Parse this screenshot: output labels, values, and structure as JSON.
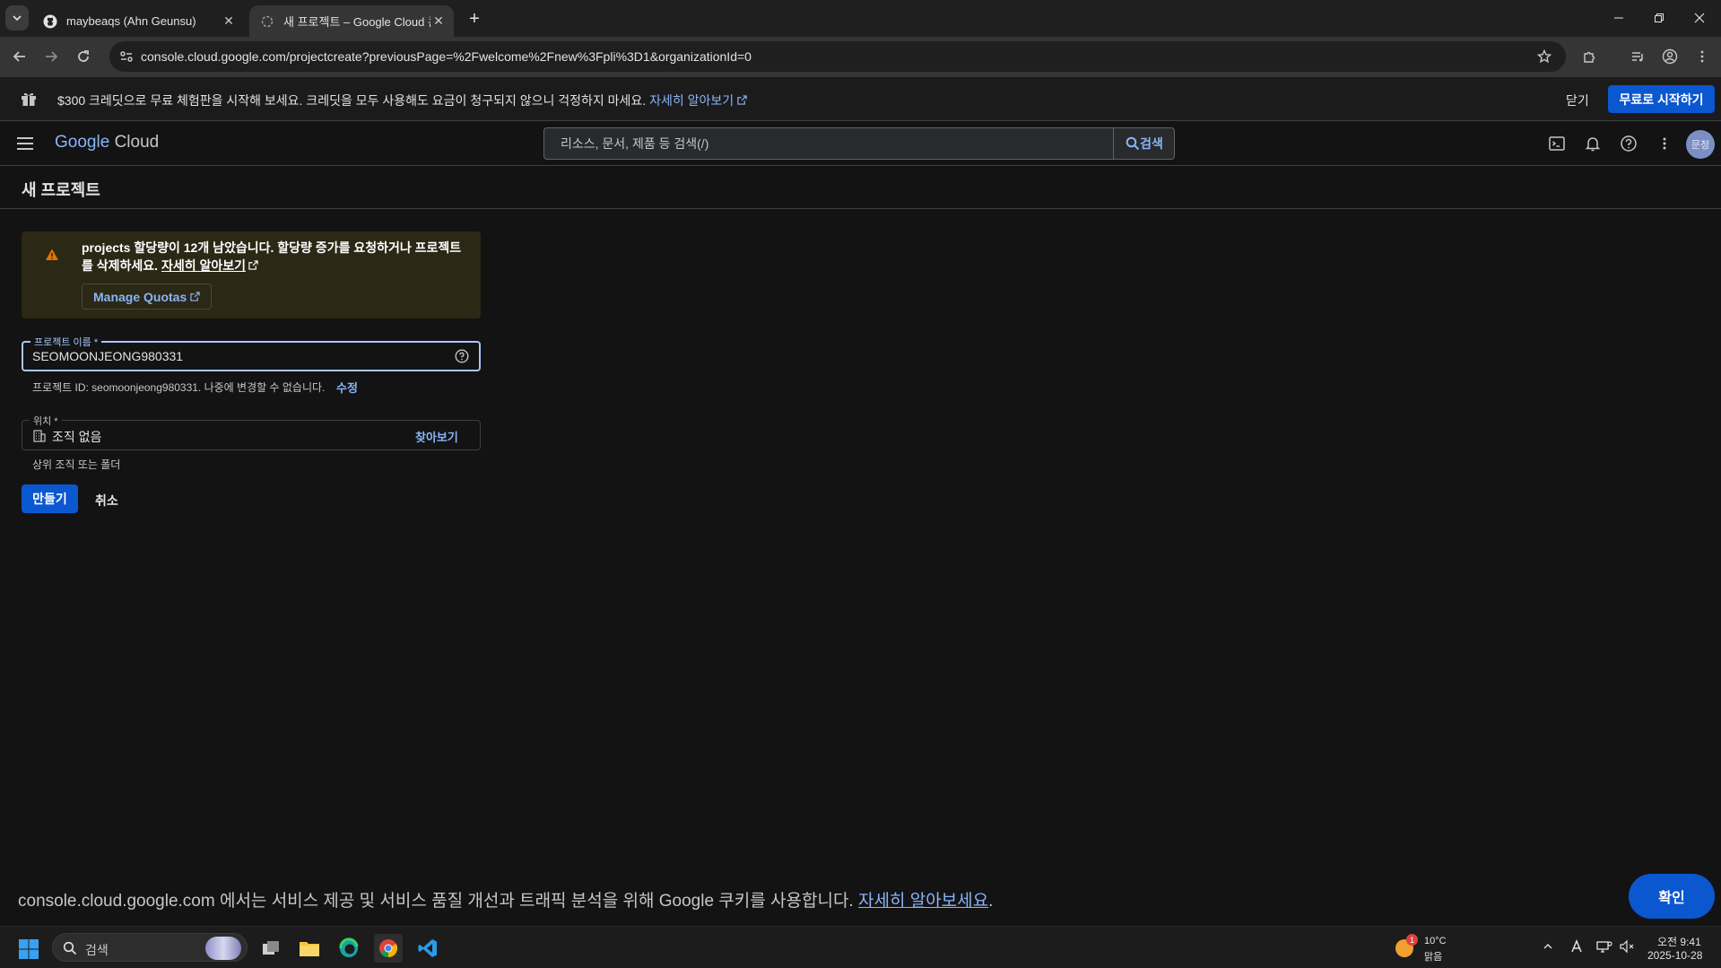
{
  "browser": {
    "tabs": [
      {
        "title": "maybeaqs (Ahn Geunsu)",
        "active": false,
        "icon": "github-icon"
      },
      {
        "title": "새 프로젝트 – Google Cloud 콘",
        "active": true,
        "icon": "cloud-loading-icon"
      }
    ],
    "url": "console.cloud.google.com/projectcreate?previousPage=%2Fwelcome%2Fnew%3Fpli%3D1&organizationId=0"
  },
  "promo": {
    "text": "$300 크레딧으로 무료 체험판을 시작해 보세요. 크레딧을 모두 사용해도 요금이 청구되지 않으니 걱정하지 마세요.",
    "link": "자세히 알아보기",
    "close_label": "닫기",
    "start_label": "무료로 시작하기"
  },
  "header": {
    "logo_google": "Google",
    "logo_cloud": "Cloud",
    "search_placeholder": "리소스, 문서, 제품 등 검색(/)",
    "search_button": "검색",
    "avatar_text": "문정"
  },
  "page": {
    "title": "새 프로젝트"
  },
  "quota": {
    "text": "projects 할당량이 12개 남았습니다. 할당량 증가를 요청하거나 프로젝트를 삭제하세요.",
    "learn_more": "자세히 알아보기",
    "manage_label": "Manage Quotas"
  },
  "form": {
    "name_label": "프로젝트 이름 *",
    "name_value": "SEOMOONJEONG980331",
    "project_id_text": "프로젝트 ID: seomoonjeong980331. 나중에 변경할 수 없습니다.",
    "project_id_edit": "수정",
    "location_label": "위치 *",
    "location_value": "조직 없음",
    "browse_label": "찾아보기",
    "location_hint": "상위 조직 또는 폴더",
    "create_label": "만들기",
    "cancel_label": "취소"
  },
  "cookie": {
    "text": "console.cloud.google.com 에서는 서비스 제공 및 서비스 품질 개선과 트래픽 분석을 위해 Google 쿠키를 사용합니다. ",
    "link": "자세히 알아보세요",
    "suffix": ".",
    "ok_label": "확인"
  },
  "taskbar": {
    "search_label": "검색",
    "weather_temp": "10°C",
    "weather_cond": "맑음",
    "weather_badge": "1",
    "time": "오전 9:41",
    "date": "2025-10-28"
  },
  "colors": {
    "accent": "#0b57d0",
    "link": "#8ab4f8",
    "background": "#131314",
    "warning": "#e37400"
  }
}
